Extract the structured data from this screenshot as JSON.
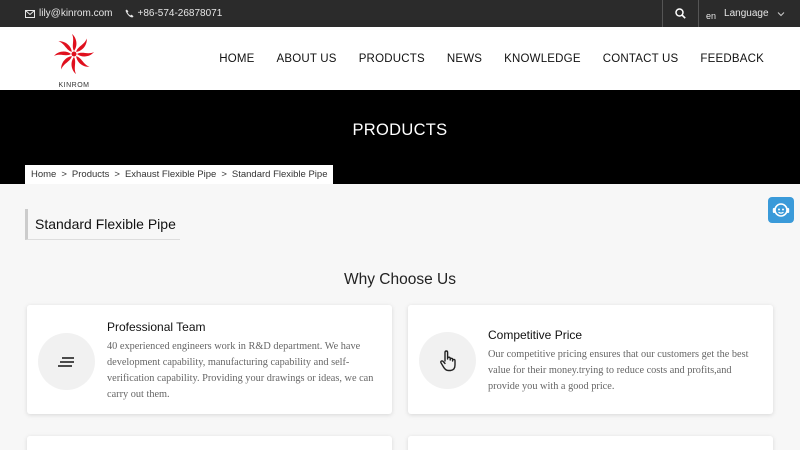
{
  "topbar": {
    "email": "lily@kinrom.com",
    "phone": "+86-574-26878071",
    "lang_code": "en",
    "lang_label": "Language"
  },
  "logo": {
    "brand": "KINROM",
    "color": "#e0101e"
  },
  "nav": [
    {
      "label": "HOME"
    },
    {
      "label": "ABOUT US"
    },
    {
      "label": "PRODUCTS"
    },
    {
      "label": "NEWS"
    },
    {
      "label": "KNOWLEDGE"
    },
    {
      "label": "CONTACT US"
    },
    {
      "label": "FEEDBACK"
    }
  ],
  "banner": {
    "title": "PRODUCTS"
  },
  "breadcrumb": [
    {
      "label": "Home"
    },
    {
      "label": "Products"
    },
    {
      "label": "Exhaust Flexible Pipe"
    },
    {
      "label": "Standard Flexible Pipe"
    }
  ],
  "breadcrumb_sep": ">",
  "page_title": "Standard Flexible Pipe",
  "section": {
    "title": "Why Choose Us"
  },
  "features": [
    {
      "icon": "list-icon",
      "title": "Professional Team",
      "text": "40 experienced engineers work in R&D department. We have development capability, manufacturing capability and self-verification capability. Providing your drawings or ideas, we can carry out them."
    },
    {
      "icon": "hand-pointer-icon",
      "title": "Competitive Price",
      "text": "Our competitive pricing ensures that our customers get the best value for their money.trying to reduce costs and profits,and provide you with a good price."
    }
  ],
  "colors": {
    "topbar": "#2b2b2b",
    "banner": "#000000",
    "chat": "#3a9ad9"
  }
}
